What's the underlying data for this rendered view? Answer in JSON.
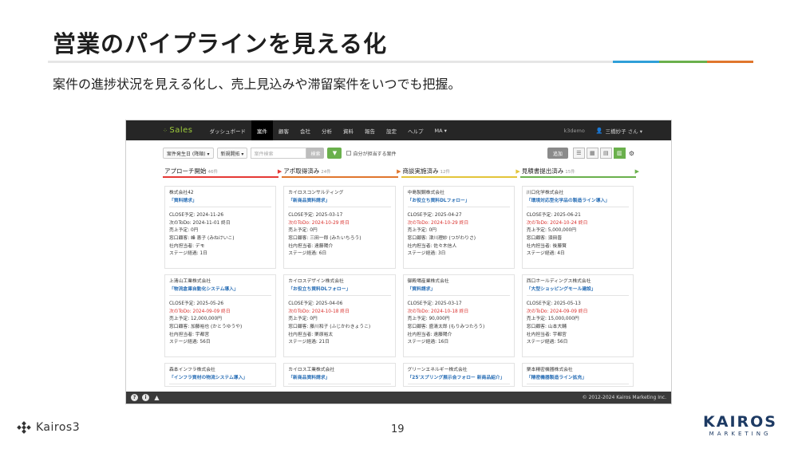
{
  "slide": {
    "title": "営業のパイプラインを見える化",
    "subtitle": "案件の進捗状況を見える化し、売上見込みや滞留案件をいつでも把握。",
    "page_number": "19",
    "accent_colors": [
      "#2f9fd8",
      "#6ab04c",
      "#e0762d"
    ],
    "footer_brand": "Kairos3",
    "corp_logo_main": "KAIROS",
    "corp_logo_sub": "MARKETING"
  },
  "app": {
    "logo": "Sales",
    "logo_icon": "dots-icon",
    "nav": [
      "ダッシュボード",
      "案件",
      "顧客",
      "会社",
      "分析",
      "資料",
      "報告",
      "設定",
      "ヘルプ",
      "MA ▾"
    ],
    "nav_active_index": 1,
    "tenant": "k3demo",
    "user": "三橋妙子 さん ▾",
    "toolbar": {
      "sort_select": "案件発生日 (降順) ▾",
      "filter_select": "新規開拓 ▾",
      "search_placeholder": "案件検索",
      "search_button": "検索",
      "filter_icon": "▼",
      "own_only_label": "自分が担当する案件",
      "add_button": "追加",
      "view_icons": [
        "list-view-icon",
        "grid-view-icon",
        "table-view-icon",
        "kanban-view-icon"
      ],
      "gear_icon": "gear-icon"
    },
    "columns": [
      {
        "name": "アプローチ開始",
        "count": "46件",
        "color": "#e53935",
        "cards": [
          {
            "company": "株式会社42",
            "deal": "「資料請求」",
            "close": "CLOSE予定: 2024-11-26",
            "todo": "次のToDo: 2024-11-01 終日",
            "sales": "売上予定: 0円",
            "contact": "窓口顧客: 峰 恵子 (みねけいこ)",
            "owner": "社内担当者: デモ",
            "stage": "ステージ経過: 1日",
            "todo_red": false
          },
          {
            "company": "上清山工業株式会社",
            "deal": "「物流倉庫自動化システム導入」",
            "close": "CLOSE予定: 2025-05-26",
            "todo": "次のToDo: 2024-09-09 終日",
            "sales": "売上予定: 12,000,000円",
            "contact": "窓口顧客: 加藤裕也 (かとうゆうや)",
            "owner": "社内担当者: 宇都宮",
            "stage": "ステージ経過: 56日",
            "todo_red": true
          },
          {
            "company": "森本インフラ株式会社",
            "deal": "「インフラ資材の物流システム導入」"
          }
        ]
      },
      {
        "name": "アポ取得済み",
        "count": "24件",
        "color": "#e0762d",
        "cards": [
          {
            "company": "カイロスコンサルティング",
            "deal": "「新商品資料請求」",
            "close": "CLOSE予定: 2025-03-17",
            "todo": "次のToDo: 2024-10-29 終日",
            "sales": "売上予定: 0円",
            "contact": "窓口顧客: 三田一郎 (みたいちろう)",
            "owner": "社内担当者: 遠藤陽介",
            "stage": "ステージ経過: 6日",
            "todo_red": true
          },
          {
            "company": "カイロスデザイン株式会社",
            "deal": "「お役立ち資料DLフォロー」",
            "close": "CLOSE予定: 2025-04-06",
            "todo": "次のToDo: 2024-10-18 終日",
            "sales": "売上予定: 0円",
            "contact": "窓口顧客: 藤川和子 (ふじかわきょうこ)",
            "owner": "社内担当者: 栗原裕太",
            "stage": "ステージ経過: 21日",
            "todo_red": true
          },
          {
            "company": "カイロス工業株式会社",
            "deal": "「新商品資料請求」"
          }
        ]
      },
      {
        "name": "商談実施済み",
        "count": "12件",
        "color": "#e3c53a",
        "cards": [
          {
            "company": "中島製鋼株式会社",
            "deal": "「お役立ち資料DLフォロー」",
            "close": "CLOSE予定: 2025-04-27",
            "todo": "次のToDo: 2024-10-29 終日",
            "sales": "売上予定: 0円",
            "contact": "窓口顧客: 津川理紗 (つがわりさ)",
            "owner": "社内担当者: 佐々木信人",
            "stage": "ステージ経過: 3日",
            "todo_red": true
          },
          {
            "company": "御殿場産業株式会社",
            "deal": "「資料請求」",
            "close": "CLOSE予定: 2025-03-17",
            "todo": "次のToDo: 2024-10-18 終日",
            "sales": "売上予定: 90,000円",
            "contact": "窓口顧客: 盛清太郎 (もりみつたろう)",
            "owner": "社内担当者: 遠藤陽介",
            "stage": "ステージ経過: 16日",
            "todo_red": true
          },
          {
            "company": "グリーンエネルギー株式会社",
            "deal": "「25'スプリング展示会フォロー 新商品紹介」"
          }
        ]
      },
      {
        "name": "見積書提出済み",
        "count": "15件",
        "color": "#6ab04c",
        "cards": [
          {
            "company": "川口化学株式会社",
            "deal": "「環境対応型化学品の製造ライン導入」",
            "close": "CLOSE予定: 2025-06-21",
            "todo": "次のToDo: 2024-10-24 終日",
            "sales": "売上予定: 5,000,000円",
            "contact": "窓口顧客: 須田晋",
            "owner": "社内担当者: 後藤賢",
            "stage": "ステージ経過: 4日",
            "todo_red": true
          },
          {
            "company": "西口ホールディングス株式会社",
            "deal": "「大型ショッピングモール建設」",
            "close": "CLOSE予定: 2025-05-13",
            "todo": "次のToDo: 2024-09-09 終日",
            "sales": "売上予定: 15,000,000円",
            "contact": "窓口顧客: 山本大輔",
            "owner": "社内担当者: 宇都宮",
            "stage": "ステージ経過: 56日",
            "todo_red": true
          },
          {
            "company": "栗本精密機器株式会社",
            "deal": "「精密機器製造ライン拡充」"
          }
        ]
      }
    ],
    "statusbar": {
      "icons": [
        "help-icon",
        "info-icon",
        "warning-icon"
      ],
      "copyright": "© 2012-2024 Kairos Marketing Inc."
    }
  }
}
